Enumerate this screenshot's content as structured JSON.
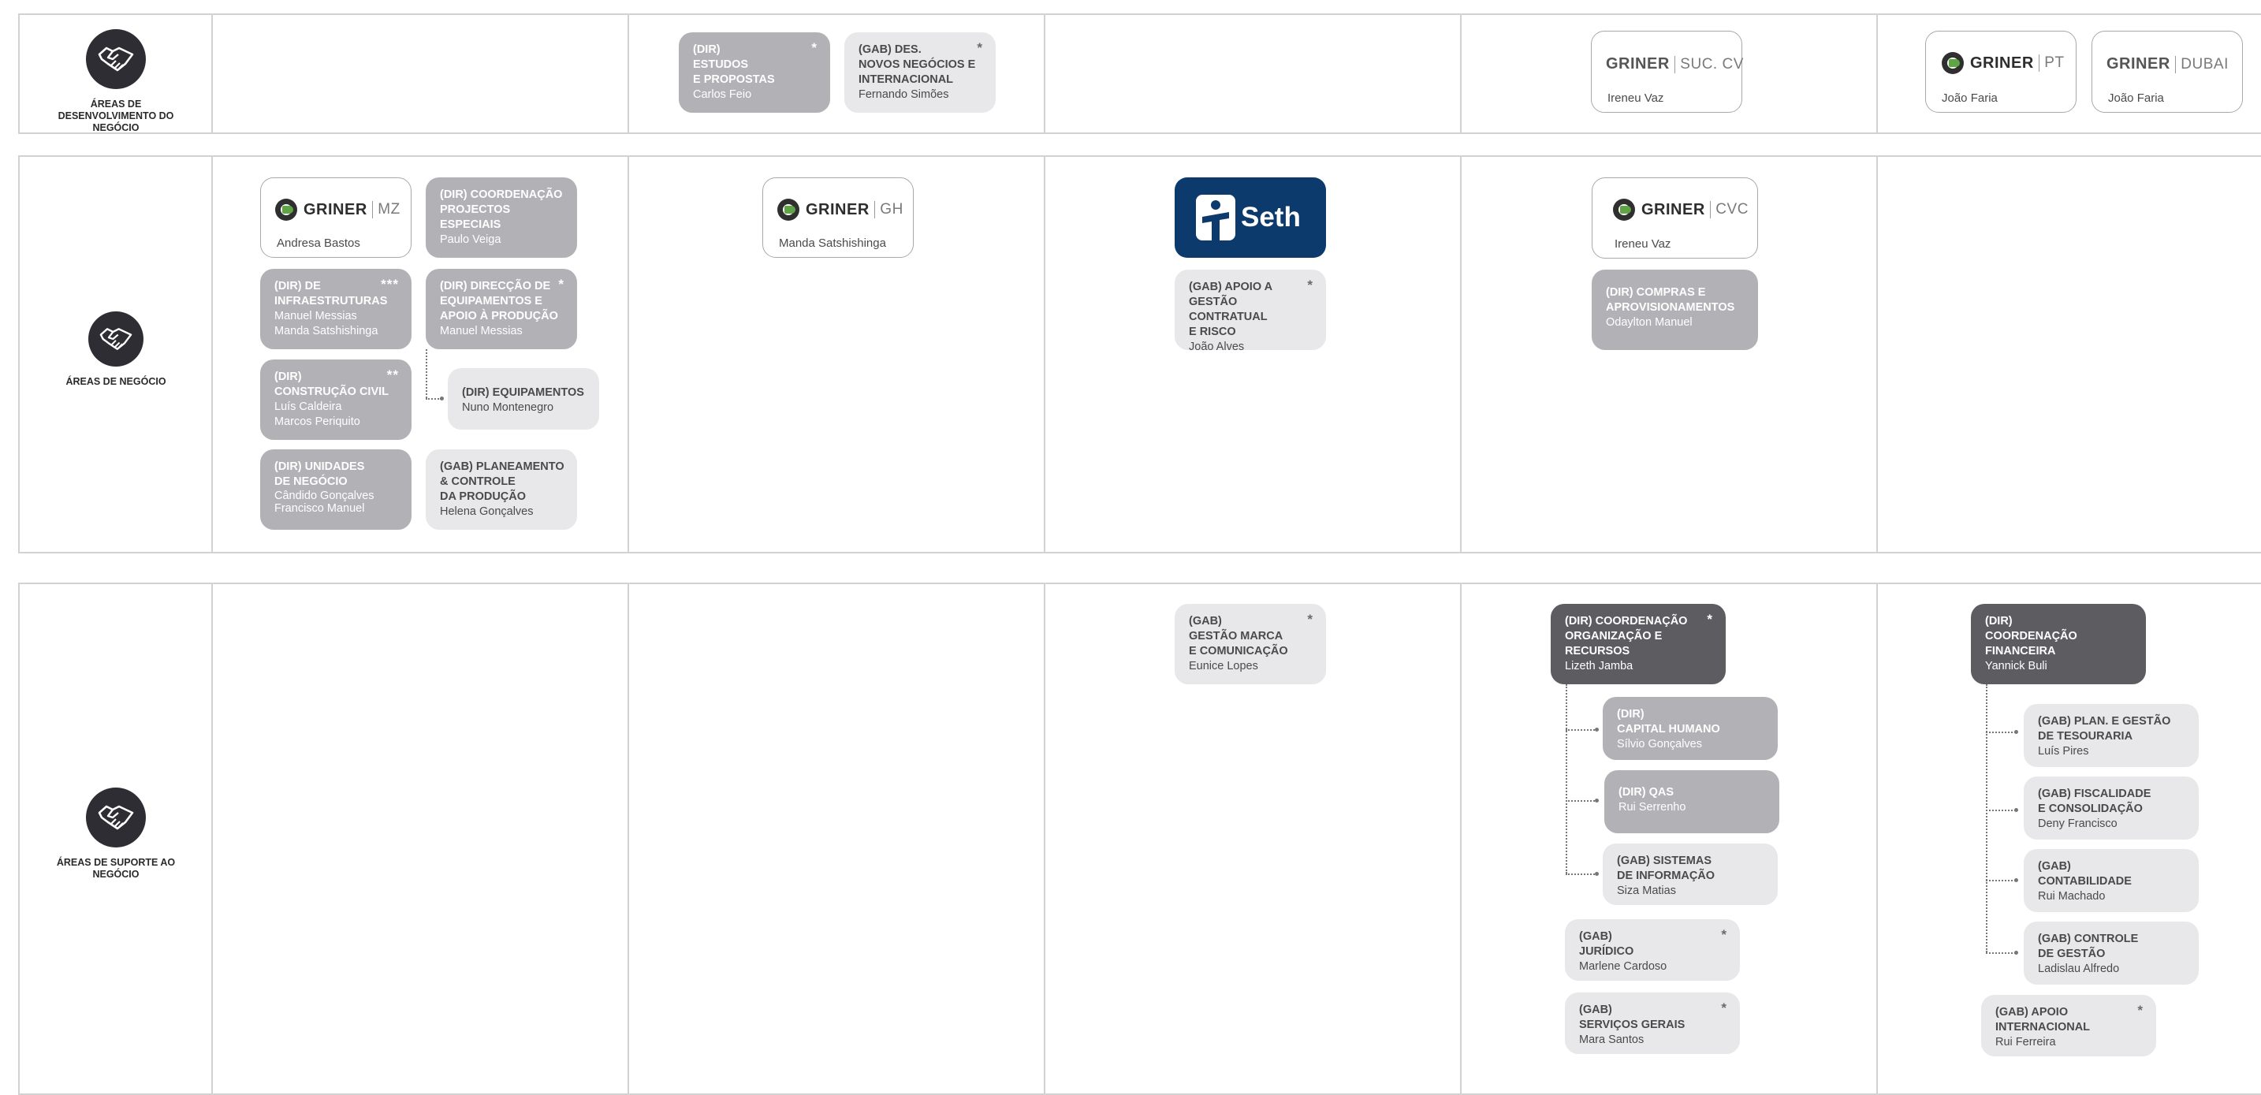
{
  "areas": {
    "desenvolvimento": "ÁREAS DE DESENVOLVIMENTO DO NEGÓCIO",
    "negocio": "ÁREAS DE NEGÓCIO",
    "suporte": "ÁREAS DE SUPORTE AO NEGÓCIO",
    "icon": "handshake-icon"
  },
  "colors": {
    "border": "#d2d2d2",
    "card_mid": "#b2b1b6",
    "card_light": "#e8e8ea",
    "card_dark": "#5d5c61",
    "seth_blue": "#0c3a6c",
    "griner_green": "#5fa545",
    "icon_dark": "#2d2d33"
  },
  "dev": {
    "estudos": {
      "title": "(DIR)\nESTUDOS\nE PROPOSTAS",
      "person": "Carlos Feio",
      "mark": "*"
    },
    "desnegocios": {
      "title": "(GAB) DES.\nNOVOS NEGÓCIOS E\nINTERNACIONAL",
      "person": "Fernando Simões",
      "mark": "*"
    },
    "suc_cv": {
      "brand": "GRINER",
      "suffix": "SUC. CV",
      "person": "Ireneu Vaz"
    },
    "pt": {
      "brand": "GRINER",
      "suffix": "PT",
      "person": "João Faria"
    },
    "dubai": {
      "brand": "GRINER",
      "suffix": "DUBAI",
      "person": "João Faria"
    }
  },
  "negocio": {
    "mz": {
      "brand": "GRINER",
      "suffix": "MZ",
      "person": "Andresa Bastos"
    },
    "coord_proj": {
      "title": "(DIR) COORDENAÇÃO\nPROJECTOS ESPECIAIS",
      "person": "Paulo Veiga"
    },
    "infra": {
      "title": "(DIR) DE\nINFRAESTRUTURAS",
      "person": "Manuel Messias\nManda Satshishinga",
      "mark": "***"
    },
    "direccao_equip": {
      "title": "(DIR) DIRECÇÃO DE\nEQUIPAMENTOS E\nAPOIO À PRODUÇÃO",
      "person": "Manuel Messias",
      "mark": "*"
    },
    "construcao": {
      "title": "(DIR)\nCONSTRUÇÃO CIVIL",
      "person": "Luís Caldeira\nMarcos Periquito",
      "mark": "**"
    },
    "equipamentos": {
      "title": "(DIR)  EQUIPAMENTOS",
      "person": "Nuno Montenegro"
    },
    "unidades": {
      "title": "(DIR) UNIDADES\nDE NEGÓCIO",
      "person": "Cândido Gonçalves\nFrancisco Manuel"
    },
    "planeamento": {
      "title": "(GAB) PLANEAMENTO\n& CONTROLE\nDA PRODUÇÃO",
      "person": "Helena Gonçalves"
    },
    "gh": {
      "brand": "GRINER",
      "suffix": "GH",
      "person": "Manda Satshishinga"
    },
    "seth": {
      "brand": "Seth"
    },
    "apoio_gestao": {
      "title": "(GAB) APOIO A\nGESTÃO CONTRATUAL\nE RISCO",
      "person": "João Alves",
      "mark": "*"
    },
    "cvc": {
      "brand": "GRINER",
      "suffix": "CVC",
      "person": "Ireneu Vaz"
    },
    "compras": {
      "title": "(DIR) COMPRAS E\nAPROVISIONAMENTOS",
      "person": "Odaylton Manuel"
    }
  },
  "suporte": {
    "marca": {
      "title": "(GAB)\nGESTÃO MARCA\nE COMUNICAÇÃO",
      "person": "Eunice Lopes",
      "mark": "*"
    },
    "coord_org": {
      "title": "(DIR) COORDENAÇÃO\nORGANIZAÇÃO E\nRECURSOS",
      "person": "Lizeth Jamba",
      "mark": "*"
    },
    "capital": {
      "title": "(DIR)\nCAPITAL HUMANO",
      "person": "Sílvio Gonçalves"
    },
    "qas": {
      "title": "(DIR) QAS",
      "person": "Rui Serrenho"
    },
    "sistemas": {
      "title": "(GAB) SISTEMAS\nDE INFORMAÇÃO",
      "person": "Siza Matias"
    },
    "juridico": {
      "title": "(GAB)\nJURÍDICO",
      "person": "Marlene Cardoso",
      "mark": "*"
    },
    "servicos": {
      "title": "(GAB)\nSERVIÇOS GERAIS",
      "person": "Mara Santos",
      "mark": "*"
    },
    "coord_fin": {
      "title": "(DIR)\nCOORDENAÇÃO\nFINANCEIRA",
      "person": "Yannick Buli"
    },
    "tesouraria": {
      "title": "(GAB) PLAN. E GESTÃO\nDE TESOURARIA",
      "person": "Luís Pires"
    },
    "fiscalidade": {
      "title": "(GAB) FISCALIDADE\nE CONSOLIDAÇÃO",
      "person": "Deny Francisco"
    },
    "contabilidade": {
      "title": "(GAB)\nCONTABILIDADE",
      "person": "Rui Machado"
    },
    "controle": {
      "title": "(GAB) CONTROLE\nDE GESTÃO",
      "person": "Ladislau Alfredo"
    },
    "apoio_int": {
      "title": "(GAB) APOIO\nINTERNACIONAL",
      "person": "Rui Ferreira",
      "mark": "*"
    }
  }
}
